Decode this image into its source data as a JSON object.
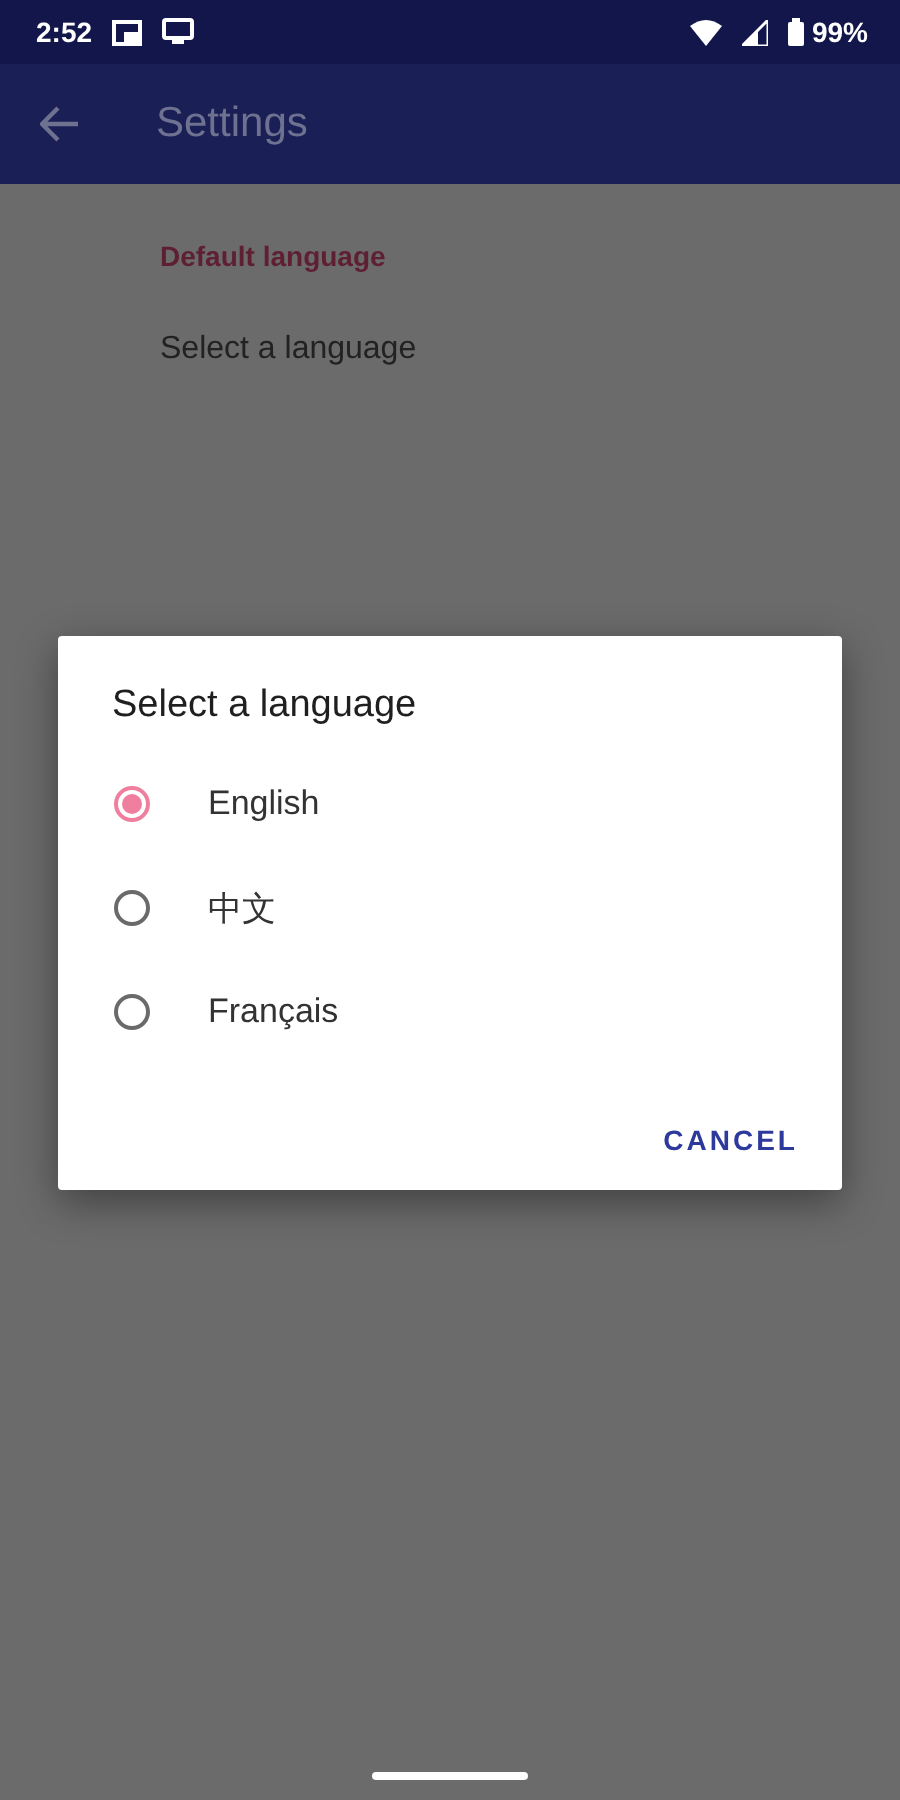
{
  "status_bar": {
    "time": "2:52",
    "battery": "99%"
  },
  "toolbar": {
    "title": "Settings"
  },
  "preferences": {
    "category": "Default language",
    "items": [
      {
        "title": "Select a language"
      }
    ]
  },
  "dialog": {
    "title": "Select a language",
    "options": [
      {
        "label": "English",
        "selected": true
      },
      {
        "label": "中文",
        "selected": false
      },
      {
        "label": "Français",
        "selected": false
      }
    ],
    "buttons": [
      "CANCEL"
    ]
  }
}
